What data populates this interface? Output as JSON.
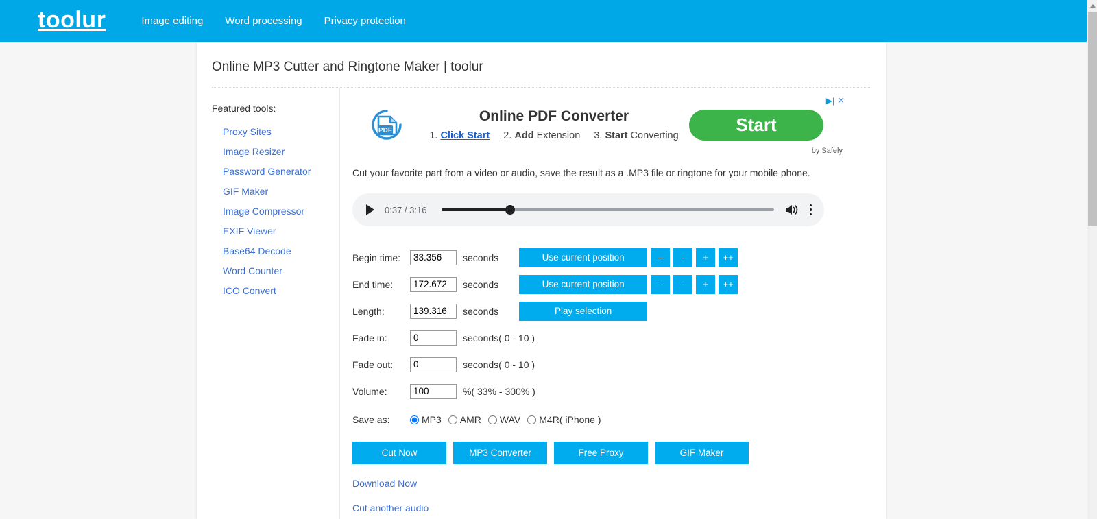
{
  "nav": {
    "brand": "toolur",
    "links": [
      "Image editing",
      "Word processing",
      "Privacy protection"
    ]
  },
  "page": {
    "title": "Online MP3 Cutter and Ringtone Maker | toolur",
    "description": "Cut your favorite part from a video or audio, save the result as a .MP3 file or ringtone for your mobile phone."
  },
  "sidebar": {
    "heading": "Featured tools:",
    "items": [
      "Proxy Sites",
      "Image Resizer",
      "Password Generator",
      "GIF Maker",
      "Image Compressor",
      "EXIF Viewer",
      "Base64 Decode",
      "Word Counter",
      "ICO Convert"
    ]
  },
  "ad": {
    "headline": "Online PDF Converter",
    "step1_num": "1.",
    "step1_link": "Click Start",
    "step2_num": "2.",
    "step2_bold": "Add",
    "step2_rest": "Extension",
    "step3_num": "3.",
    "step3_bold": "Start",
    "step3_rest": "Converting",
    "cta": "Start",
    "attribution": "by Safely",
    "icon_label": "PDF",
    "adchoices_icon": "adchoices-triangle-icon",
    "close_icon": "close-x-icon",
    "cta_color": "#3cb44a"
  },
  "player": {
    "play_icon": "play-triangle-icon",
    "time": "0:37 / 3:16",
    "volume_icon": "volume-high-icon",
    "more_icon": "more-vertical-icon",
    "progress_percent": 20.5
  },
  "form": {
    "begin": {
      "label": "Begin time:",
      "value": "33.356",
      "unit": "seconds"
    },
    "end": {
      "label": "End time:",
      "value": "172.672",
      "unit": "seconds"
    },
    "length": {
      "label": "Length:",
      "value": "139.316",
      "unit": "seconds"
    },
    "fade_in": {
      "label": "Fade in:",
      "value": "0",
      "unit": "seconds( 0 - 10 )"
    },
    "fade_out": {
      "label": "Fade out:",
      "value": "0",
      "unit": "seconds( 0 - 10 )"
    },
    "volume": {
      "label": "Volume:",
      "value": "100",
      "unit": "%( 33% - 300% )"
    },
    "use_current_position": "Use current position",
    "play_selection": "Play selection",
    "step_minus_minus": "--",
    "step_minus": "-",
    "step_plus": "+",
    "step_plus_plus": "++",
    "save_as_label": "Save as:",
    "save_as_options": [
      "MP3",
      "AMR",
      "WAV",
      "M4R( iPhone )"
    ],
    "save_as_selected": "MP3"
  },
  "actions": [
    "Cut Now",
    "MP3 Converter",
    "Free Proxy",
    "GIF Maker"
  ],
  "bottom_links": [
    "Download Now",
    "Cut another audio"
  ],
  "colors": {
    "brand_blue": "#00a8e8",
    "button_blue": "#00aced",
    "link_blue": "#3b6fd4"
  }
}
